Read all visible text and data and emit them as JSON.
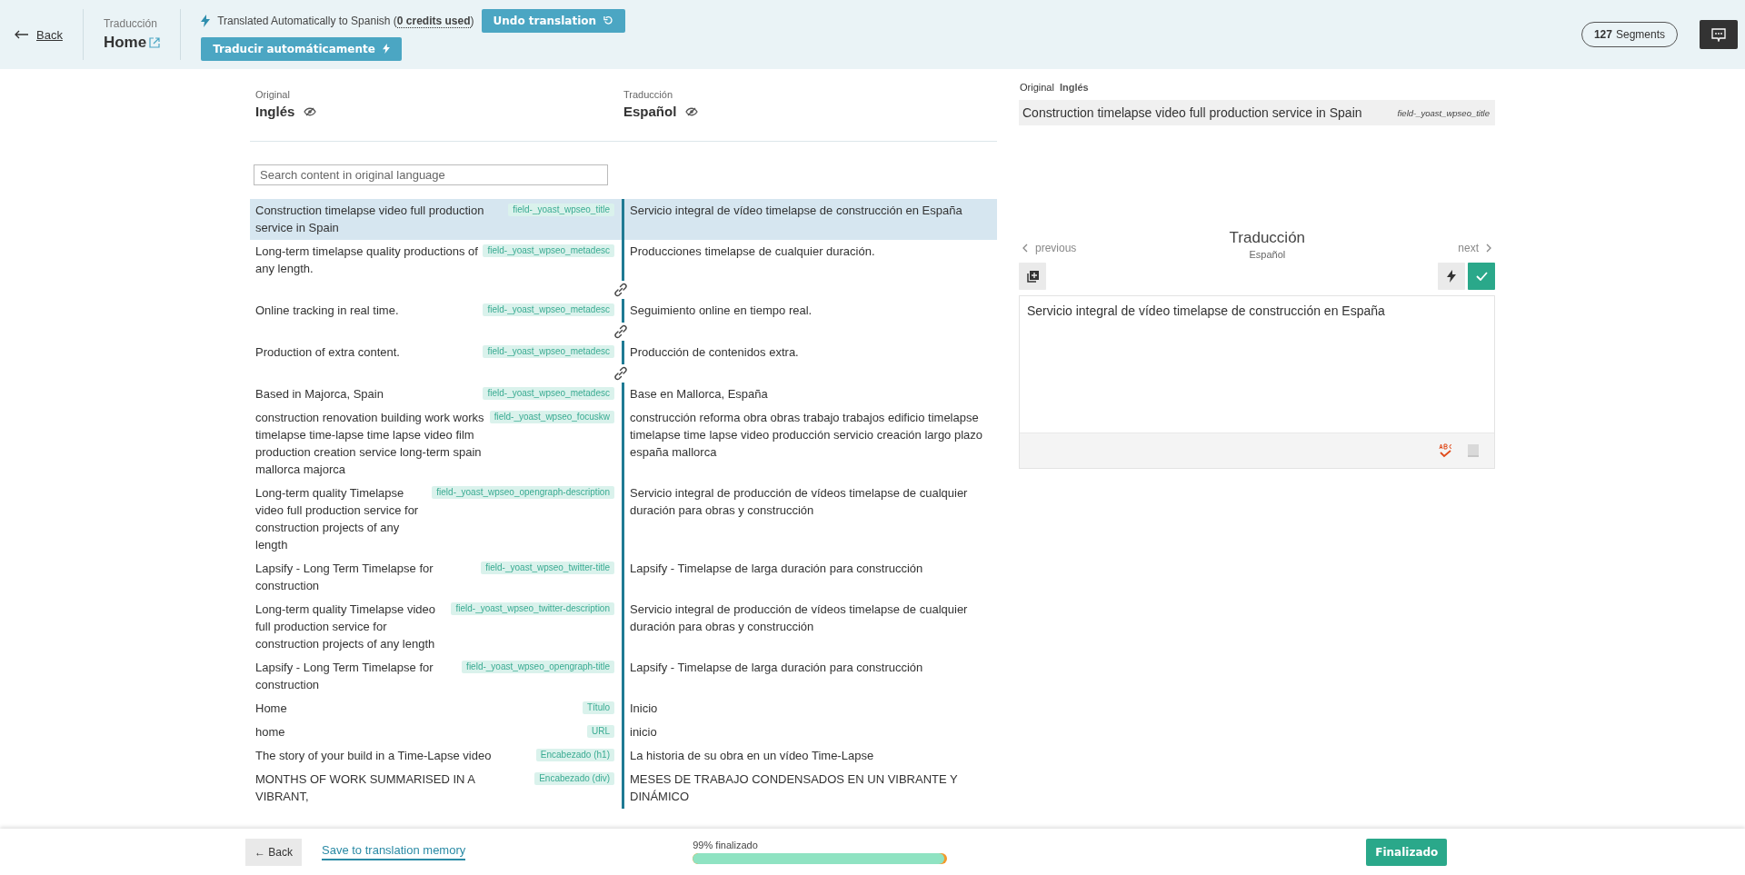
{
  "header": {
    "back": "Back",
    "section_label": "Traducción",
    "page_title": "Home",
    "auto_status_prefix": "Translated Automatically to Spanish (",
    "auto_status_credits": "0 credits used",
    "auto_status_suffix": ")",
    "undo_button": "Undo translation",
    "auto_translate_button": "Traducir automáticamente",
    "segments_count": "127",
    "segments_label": "Segments"
  },
  "columns": {
    "original_label": "Original",
    "original_language": "Inglés",
    "translation_label": "Traducción",
    "translation_language": "Español"
  },
  "search": {
    "placeholder": "Search content in original language"
  },
  "segments": [
    {
      "source": "Construction timelapse video full production service in Spain",
      "field": "field-_yoast_wpseo_title",
      "target": "Servicio integral de vídeo timelapse de construcción en España",
      "selected": true,
      "linked_to_next": false
    },
    {
      "source": "Long-term timelapse quality productions of any length.",
      "field": "field-_yoast_wpseo_metadesc",
      "target": "Producciones timelapse de cualquier duración.",
      "selected": false,
      "linked_to_next": true
    },
    {
      "source": "Online tracking in real time.",
      "field": "field-_yoast_wpseo_metadesc",
      "target": "Seguimiento online en tiempo real.",
      "selected": false,
      "linked_to_next": true
    },
    {
      "source": "Production of extra content.",
      "field": "field-_yoast_wpseo_metadesc",
      "target": "Producción de contenidos extra.",
      "selected": false,
      "linked_to_next": true
    },
    {
      "source": "Based in Majorca, Spain",
      "field": "field-_yoast_wpseo_metadesc",
      "target": "Base en Mallorca, España",
      "selected": false,
      "linked_to_next": false
    },
    {
      "source": "construction renovation building work works timelapse time-lapse time lapse video film production creation service long-term spain mallorca majorca",
      "field": "field-_yoast_wpseo_focuskw",
      "target": "construcción reforma obra obras trabajo trabajos edificio timelapse timelapse time lapse video producción servicio creación largo plazo españa mallorca",
      "selected": false,
      "linked_to_next": false
    },
    {
      "source": "Long-term quality Timelapse video full production service for construction projects of any length",
      "field": "field-_yoast_wpseo_opengraph-description",
      "target": "Servicio integral de producción de vídeos timelapse de cualquier duración para obras y construcción",
      "selected": false,
      "linked_to_next": false
    },
    {
      "source": "Lapsify - Long Term Timelapse for construction",
      "field": "field-_yoast_wpseo_twitter-title",
      "target": "Lapsify - Timelapse de larga duración para construcción",
      "selected": false,
      "linked_to_next": false
    },
    {
      "source": "Long-term quality Timelapse video full production service for construction projects of any length",
      "field": "field-_yoast_wpseo_twitter-description",
      "target": "Servicio integral de producción de vídeos timelapse de cualquier duración para obras y construcción",
      "selected": false,
      "linked_to_next": false
    },
    {
      "source": "Lapsify - Long Term Timelapse for construction",
      "field": "field-_yoast_wpseo_opengraph-title",
      "target": "Lapsify - Timelapse de larga duración para construcción",
      "selected": false,
      "linked_to_next": false
    },
    {
      "source": "Home",
      "field": "Título",
      "target": "Inicio",
      "selected": false,
      "linked_to_next": false
    },
    {
      "source": "home",
      "field": "URL",
      "target": "inicio",
      "selected": false,
      "linked_to_next": false
    },
    {
      "source": "The story of your build in a Time-Lapse video",
      "field": "Encabezado (h1)",
      "target": "La historia de su obra en un vídeo Time-Lapse",
      "selected": false,
      "linked_to_next": false
    },
    {
      "source": "MONTHS OF WORK SUMMARISED IN A VIBRANT,",
      "field": "Encabezado (div)",
      "target": "MESES DE TRABAJO CONDENSADOS EN UN VIBRANTE Y DINÁMICO",
      "selected": false,
      "linked_to_next": false
    }
  ],
  "editor": {
    "original_label": "Original",
    "original_language": "Inglés",
    "original_text": "Construction timelapse video full production service in Spain",
    "original_field": "field-_yoast_wpseo_title",
    "previous": "previous",
    "title": "Traducción",
    "language": "Español",
    "next": "next",
    "value": "Servicio integral de vídeo timelapse de construcción en España"
  },
  "footer": {
    "back": "← Back",
    "save_link": "Save to translation memory",
    "progress_label": "99% finalizado",
    "level": 0.99,
    "finish_button": "Finalizado"
  }
}
